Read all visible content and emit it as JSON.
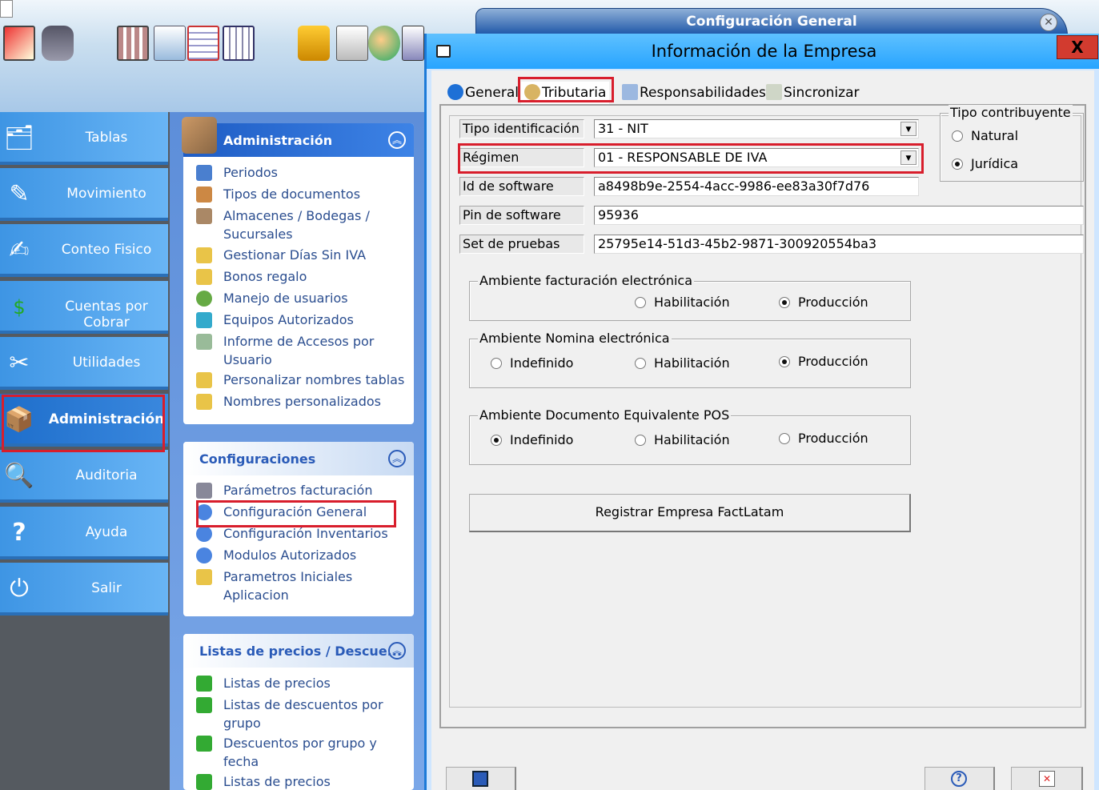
{
  "outer_window": {
    "title": "Configuración General"
  },
  "nav": {
    "items": [
      {
        "label": "Tablas",
        "icon": "tables-icon"
      },
      {
        "label": "Movimiento",
        "icon": "movement-icon"
      },
      {
        "label": "Conteo Fisico",
        "icon": "count-icon"
      },
      {
        "label": "Cuentas por Cobrar",
        "icon": "money-icon"
      },
      {
        "label": "Utilidades",
        "icon": "tools-icon"
      },
      {
        "label": "Administración",
        "icon": "admin-box-icon"
      },
      {
        "label": "Auditoria",
        "icon": "audit-icon"
      },
      {
        "label": "Ayuda",
        "icon": "help-icon"
      },
      {
        "label": "Salir",
        "icon": "power-icon"
      }
    ]
  },
  "admin_card": {
    "title": "Administración",
    "items": [
      "Periodos",
      "Tipos de documentos",
      "Almacenes / Bodegas /",
      "Sucursales",
      "Gestionar Días Sin IVA",
      "Bonos regalo",
      "Manejo de usuarios",
      "Equipos Autorizados",
      "Informe de Accesos por",
      "Usuario",
      "Personalizar nombres tablas",
      "Nombres personalizados"
    ]
  },
  "config_card": {
    "title": "Configuraciones",
    "items": [
      "Parámetros facturación",
      "Configuración General",
      "Configuración Inventarios",
      "Modulos Autorizados",
      "Parametros Iniciales",
      "Aplicacion"
    ]
  },
  "prices_card": {
    "title": "Listas de precios / Descue...",
    "items": [
      "Listas de precios",
      "Listas de descuentos por",
      "grupo",
      "Descuentos por grupo y",
      "fecha",
      "Listas de precios"
    ]
  },
  "dialog": {
    "title": "Información de la Empresa",
    "close_label": "X",
    "tabs": [
      "General",
      "Tributaria",
      "Responsabilidades",
      "Sincronizar"
    ],
    "fields": {
      "tipo_identificacion": {
        "label": "Tipo identificación",
        "value": "31 - NIT"
      },
      "regimen": {
        "label": "Régimen",
        "value": "01 - RESPONSABLE DE IVA"
      },
      "id_software": {
        "label": "Id de software",
        "value": "a8498b9e-2554-4acc-9986-ee83a30f7d76"
      },
      "pin_software": {
        "label": "Pin de software",
        "value": "95936"
      },
      "set_pruebas": {
        "label": "Set de pruebas",
        "value": "25795e14-51d3-45b2-9871-300920554ba3"
      }
    },
    "tipo_contribuyente": {
      "title": "Tipo contribuyente",
      "options": [
        "Natural",
        "Jurídica"
      ],
      "selected": "Jurídica"
    },
    "ambiente_fe": {
      "title": "Ambiente  facturación electrónica",
      "options": [
        "Habilitación",
        "Producción"
      ],
      "selected": "Producción"
    },
    "ambiente_nomina": {
      "title": "Ambiente  Nomina electrónica",
      "options": [
        "Indefinido",
        "Habilitación",
        "Producción"
      ],
      "selected": "Producción"
    },
    "ambiente_pos": {
      "title": "Ambiente  Documento Equivalente POS",
      "options": [
        "Indefinido",
        "Habilitación",
        "Producción"
      ],
      "selected": "Indefinido"
    },
    "register_button": "Registrar Empresa FactLatam"
  },
  "colors": {
    "highlight": "#d81e2c",
    "nav_blue": "#4a9ee8",
    "dialog_title": "#28a4ff"
  }
}
